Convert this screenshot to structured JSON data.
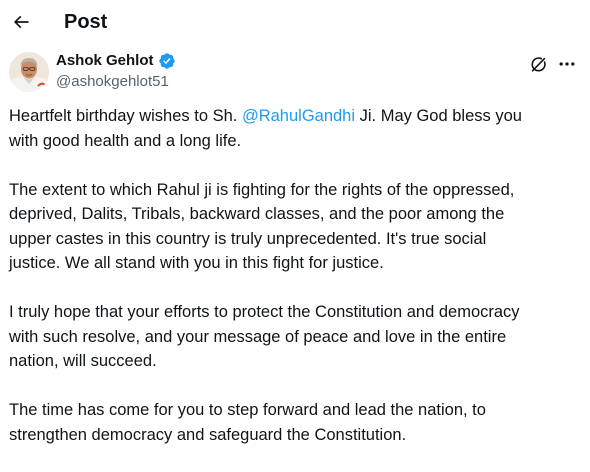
{
  "header": {
    "back_icon": "arrow-left-icon",
    "title": "Post"
  },
  "author": {
    "display_name": "Ashok Gehlot",
    "handle": "@ashokgehlot51",
    "verified": true,
    "verified_color": "#1d9bf0",
    "grok_icon": "grok-icon",
    "more_icon": "more-horizontal-icon"
  },
  "tweet": {
    "p1_before": "Heartfelt birthday wishes to Sh. ",
    "p1_mention": "@RahulGandhi",
    "p1_after_line1": " Ji. May God bless you",
    "p1_line2": "with good health and a long life.",
    "p2_lines": [
      "The extent to which Rahul ji is fighting for the rights of the oppressed,",
      "deprived, Dalits, Tribals, backward classes, and the poor among the",
      "upper castes in this country is truly unprecedented. It's true social",
      "justice. We all stand with you in this fight for justice."
    ],
    "p3_lines": [
      "I truly hope that your efforts to protect the Constitution and democracy",
      "with such resolve, and your message of peace and love in the entire",
      "nation, will succeed."
    ],
    "p4_lines": [
      "The time has come for you to step forward and lead the nation, to",
      "strengthen democracy and safeguard the Constitution."
    ]
  },
  "colors": {
    "text": "#0f1419",
    "secondary_text": "#536471",
    "link": "#1d9bf0"
  }
}
